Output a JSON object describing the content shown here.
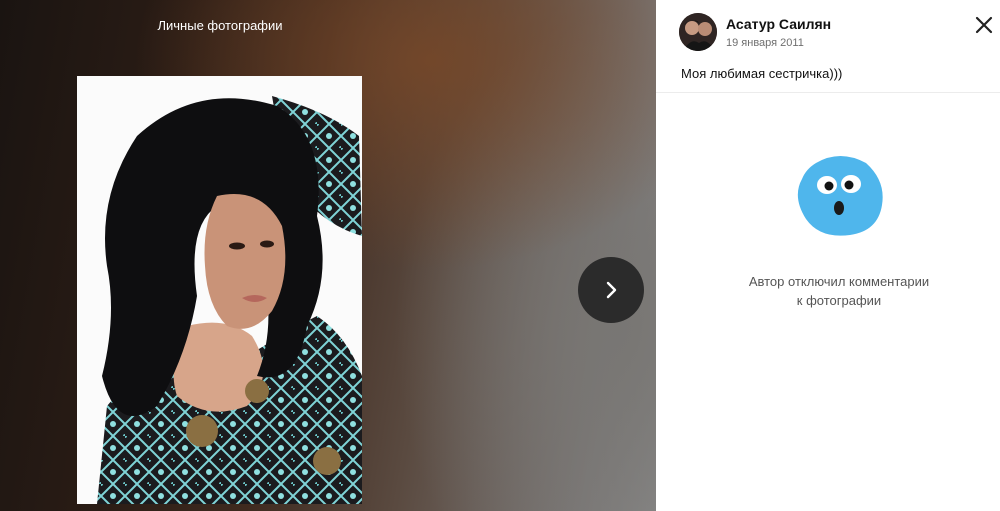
{
  "album": {
    "title": "Личные фотографии"
  },
  "navigation": {
    "next_icon": "chevron-right-icon",
    "close_icon": "close-icon"
  },
  "post": {
    "author": "Асатур Саилян",
    "date": "19 января 2011",
    "caption": "Моя любимая сестричка)))"
  },
  "comments": {
    "disabled_line1": "Автор отключил комментарии",
    "disabled_line2": "к фотографии",
    "icon": "surprised-face-icon"
  },
  "colors": {
    "panel_bg": "#ffffff",
    "next_button_bg": "#2b2b2b",
    "emoji_blue": "#4fb6ec"
  }
}
